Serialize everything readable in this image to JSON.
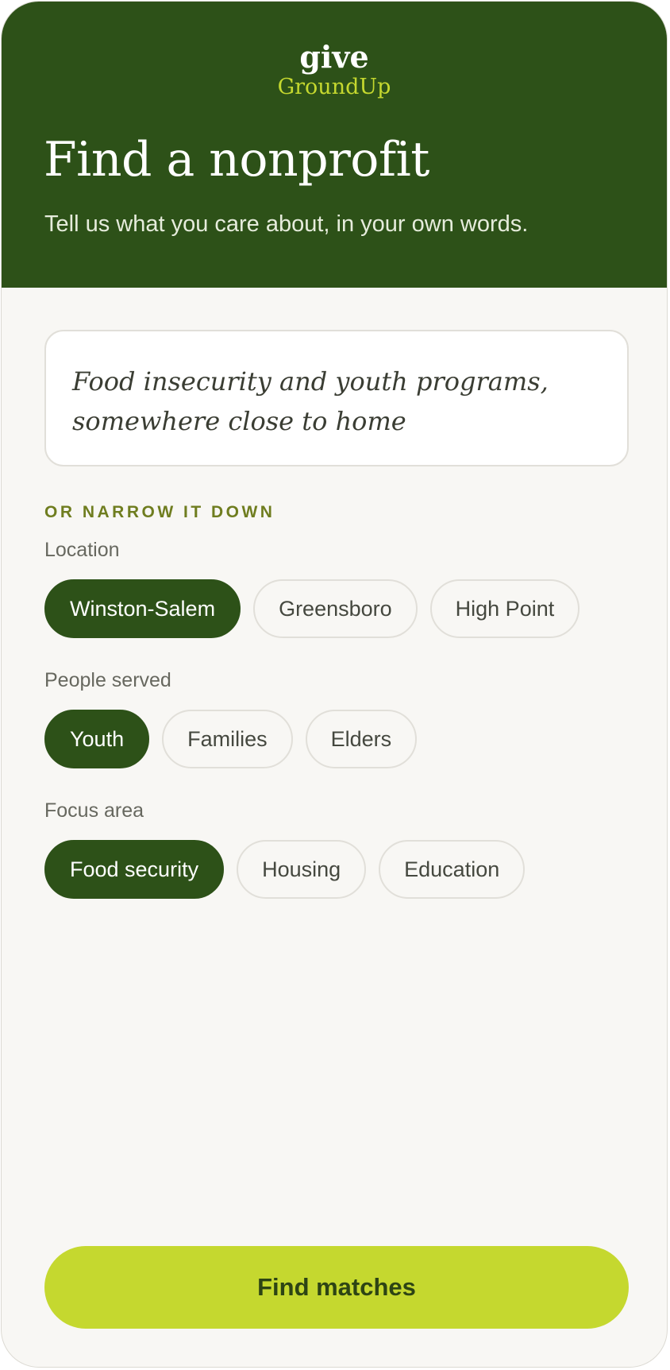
{
  "brand": {
    "top_word": "give",
    "name": "GroundUp"
  },
  "header": {
    "title": "Find a nonprofit",
    "subtitle": "Tell us what you care about, in your own words."
  },
  "search": {
    "value": "Food insecurity and youth programs, somewhere close to home"
  },
  "filters": {
    "eyebrow": "OR NARROW IT DOWN",
    "location": {
      "label": "Location",
      "options": [
        "Winston-Salem",
        "Greensboro",
        "High Point"
      ],
      "selected": "Winston-Salem"
    },
    "people": {
      "label": "People served",
      "options": [
        "Youth",
        "Families",
        "Elders"
      ],
      "selected": "Youth"
    },
    "focus": {
      "label": "Focus area",
      "options": [
        "Food security",
        "Housing",
        "Education"
      ],
      "selected": "Food security"
    }
  },
  "cta": {
    "label": "Find matches"
  },
  "colors": {
    "brand_green": "#2d5118",
    "accent_lime": "#c5d82f",
    "background": "#f8f7f4",
    "eyebrow_olive": "#6f7d1f"
  }
}
